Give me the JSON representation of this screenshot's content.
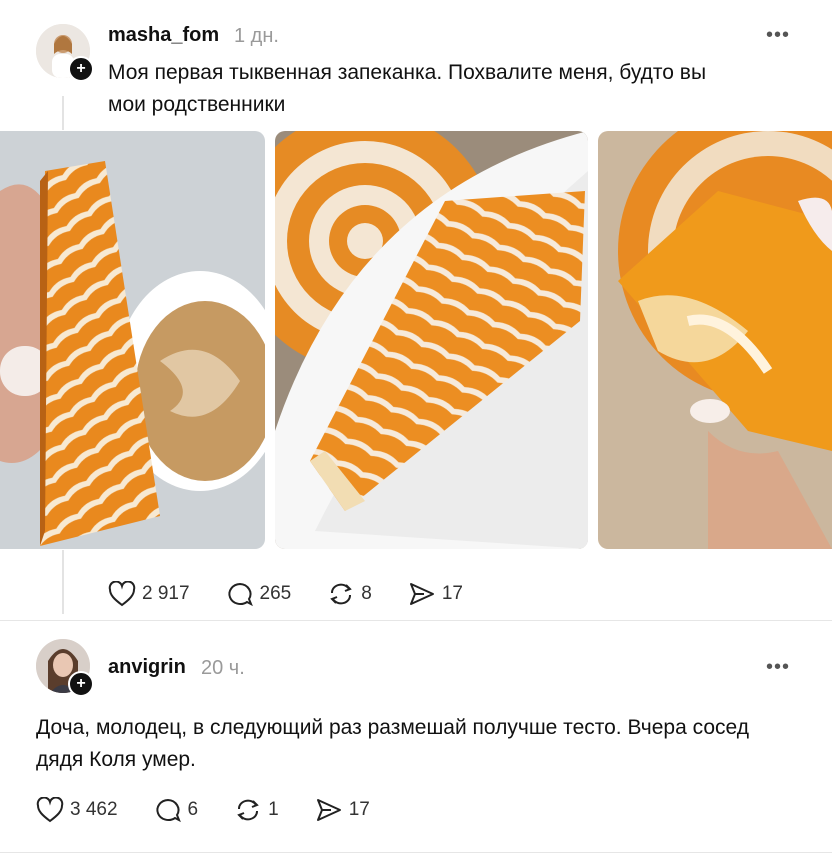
{
  "post": {
    "username": "masha_fom",
    "time": "1 дн.",
    "more": "•••",
    "text_line1": "Моя первая тыквенная запеканка. Похвалите меня, будто вы",
    "text_line2": "мои родственники",
    "plus": "+",
    "stats": {
      "likes": "2 917",
      "comments": "265",
      "reposts": "8",
      "shares": "17"
    }
  },
  "reply": {
    "username": "anvigrin",
    "time": "20 ч.",
    "more": "•••",
    "text_line1": "Доча, молодец, в следующий раз размешай получше тесто. Вчера сосед",
    "text_line2": "дядя Коля умер.",
    "plus": "+",
    "stats": {
      "likes": "3 462",
      "comments": "6",
      "reposts": "1",
      "shares": "17"
    }
  },
  "colors": {
    "text": "#111111",
    "muted": "#9a9a9a",
    "divider": "#e6e6e6",
    "orange": "#e98a1f"
  },
  "icons": [
    "heart-icon",
    "comment-icon",
    "repost-icon",
    "share-icon",
    "plus-icon",
    "more-icon"
  ]
}
